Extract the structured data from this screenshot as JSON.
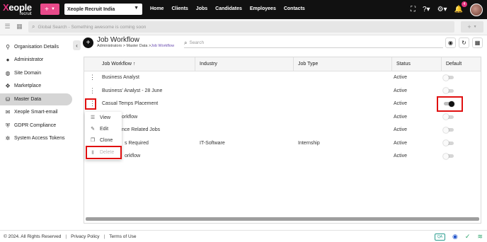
{
  "brand": {
    "logo_main": "eople",
    "logo_x": "X",
    "logo_sub": "recruit"
  },
  "topbar": {
    "plus_label": "+",
    "org_select": "Xeople Recruit India",
    "nav": [
      "Home",
      "Clients",
      "Jobs",
      "Candidates",
      "Employees",
      "Contacts"
    ],
    "notification_count": "4"
  },
  "search": {
    "global_placeholder": "Global Search - Something awesome is coming soon",
    "add_label": "+"
  },
  "sidebar": {
    "items": [
      {
        "label": "Organisation Details",
        "icon": "building-icon"
      },
      {
        "label": "Administrator",
        "icon": "user-icon"
      },
      {
        "label": "Site Domain",
        "icon": "globe-icon"
      },
      {
        "label": "Marketplace",
        "icon": "marketplace-icon"
      },
      {
        "label": "Master Data",
        "icon": "database-icon"
      },
      {
        "label": "Xeople Smart-email",
        "icon": "mail-icon"
      },
      {
        "label": "GDPR Compliance",
        "icon": "shield-icon"
      },
      {
        "label": "System Access Tokens",
        "icon": "token-icon"
      }
    ]
  },
  "main": {
    "title": "Job Workflow",
    "breadcrumb": {
      "part1": "Administrators",
      "sep": ">",
      "part2": "Master Data",
      "current": "Job Workflow"
    },
    "list_search_placeholder": "Search"
  },
  "table": {
    "columns": {
      "workflow": "Job Workflow ↑",
      "industry": "Industry",
      "job_type": "Job Type",
      "status": "Status",
      "default": "Default"
    },
    "rows": [
      {
        "workflow": "Business Analyst",
        "industry": "",
        "job_type": "",
        "status": "Active",
        "default": false
      },
      {
        "workflow": "Business' Analyst - 28 June",
        "industry": "",
        "job_type": "",
        "status": "Active",
        "default": false
      },
      {
        "workflow": "Casual Temps Placement",
        "industry": "",
        "job_type": "",
        "status": "Active",
        "default": true
      },
      {
        "workflow": "workflow",
        "industry": "",
        "job_type": "",
        "status": "Active",
        "default": false
      },
      {
        "workflow": "nce Related Jobs",
        "industry": "",
        "job_type": "",
        "status": "Active",
        "default": false
      },
      {
        "workflow": "s Required",
        "industry": "IT-Software",
        "job_type": "Internship",
        "status": "Active",
        "default": false
      },
      {
        "workflow": "orkflow",
        "industry": "",
        "job_type": "",
        "status": "Active",
        "default": false
      }
    ]
  },
  "context_menu": {
    "items": [
      {
        "label": "View",
        "icon": "list-icon"
      },
      {
        "label": "Edit",
        "icon": "pencil-icon"
      },
      {
        "label": "Clone",
        "icon": "copy-icon"
      },
      {
        "label": "Delete",
        "icon": "trash-icon"
      }
    ]
  },
  "footer": {
    "copyright": "© 2024. All Rights Reserved",
    "privacy": "Privacy Policy",
    "terms": "Terms of Use",
    "sep": "|",
    "qa_label": "QA"
  },
  "colors": {
    "brand_pink": "#e84a8a",
    "highlight_red": "#e01010",
    "topbar_bg": "#111111"
  }
}
